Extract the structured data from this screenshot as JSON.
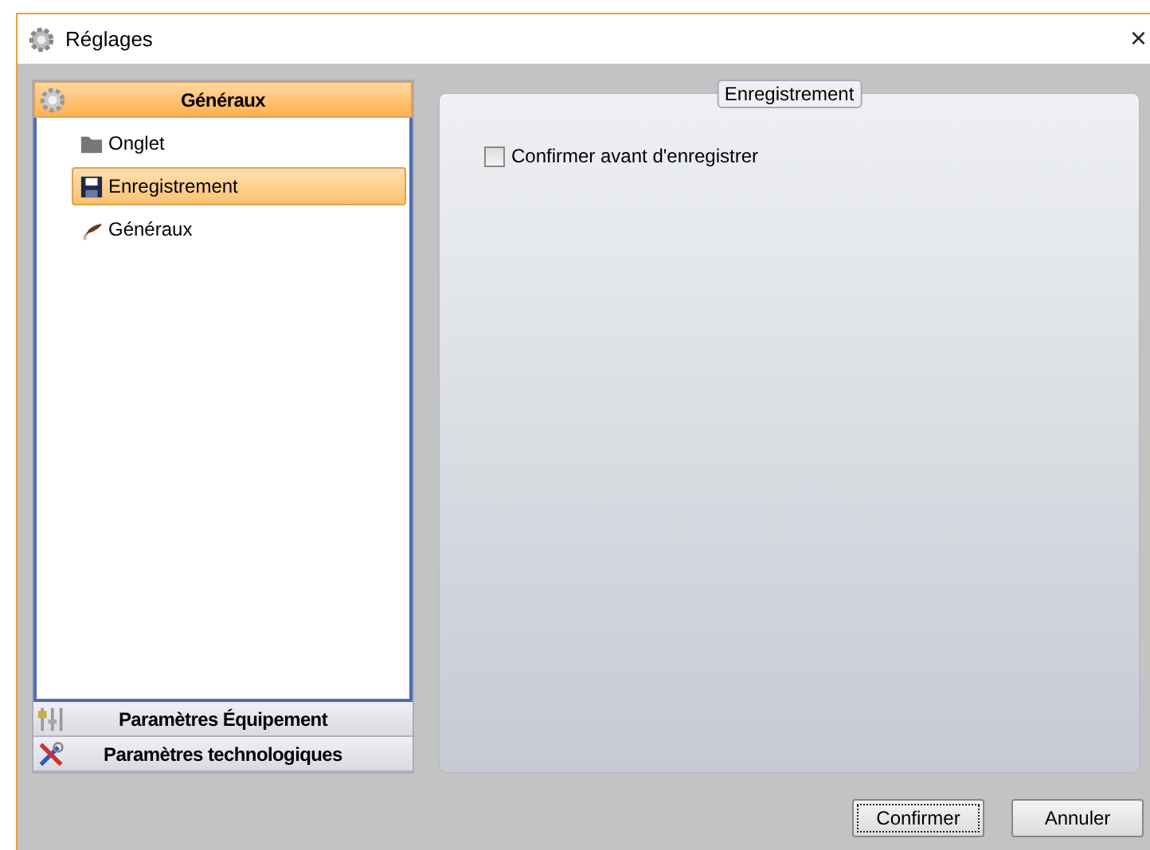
{
  "window": {
    "title": "Réglages",
    "close": "×"
  },
  "sidebar": {
    "sections": [
      {
        "label": "Généraux",
        "expanded": true,
        "items": [
          {
            "label": "Onglet",
            "selected": false
          },
          {
            "label": "Enregistrement",
            "selected": true
          },
          {
            "label": "Généraux",
            "selected": false
          }
        ]
      },
      {
        "label": "Paramètres Équipement",
        "expanded": false
      },
      {
        "label": "Paramètres technologiques",
        "expanded": false
      }
    ]
  },
  "group": {
    "title": "Enregistrement",
    "options": [
      {
        "label": "Confirmer avant d'enregistrer",
        "checked": false
      }
    ]
  },
  "buttons": [
    {
      "label": "Confirmer",
      "default": true
    },
    {
      "label": "Annuler",
      "default": false
    }
  ]
}
